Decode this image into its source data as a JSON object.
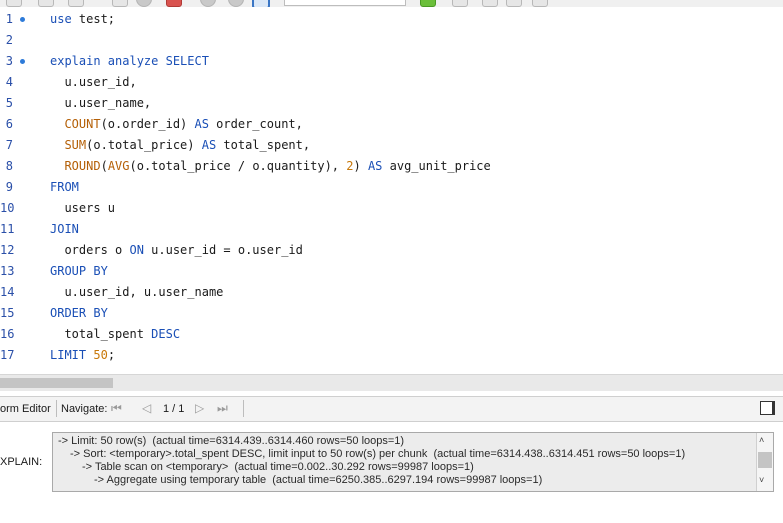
{
  "editor": {
    "lines": [
      {
        "num": "1",
        "marker": true,
        "tokens": [
          {
            "t": "use",
            "c": "kw"
          },
          {
            "t": " test;",
            "c": ""
          }
        ]
      },
      {
        "num": "2",
        "marker": false,
        "tokens": []
      },
      {
        "num": "3",
        "marker": true,
        "tokens": [
          {
            "t": "explain analyze SELECT",
            "c": "kw"
          }
        ]
      },
      {
        "num": "4",
        "marker": false,
        "tokens": [
          {
            "t": "  u.user_id,",
            "c": ""
          }
        ]
      },
      {
        "num": "5",
        "marker": false,
        "tokens": [
          {
            "t": "  u.user_name,",
            "c": ""
          }
        ]
      },
      {
        "num": "6",
        "marker": false,
        "tokens": [
          {
            "t": "  ",
            "c": ""
          },
          {
            "t": "COUNT",
            "c": "fn"
          },
          {
            "t": "(o.order_id) ",
            "c": ""
          },
          {
            "t": "AS",
            "c": "kw"
          },
          {
            "t": " order_count,",
            "c": ""
          }
        ]
      },
      {
        "num": "7",
        "marker": false,
        "tokens": [
          {
            "t": "  ",
            "c": ""
          },
          {
            "t": "SUM",
            "c": "fn"
          },
          {
            "t": "(o.total_price) ",
            "c": ""
          },
          {
            "t": "AS",
            "c": "kw"
          },
          {
            "t": " total_spent,",
            "c": ""
          }
        ]
      },
      {
        "num": "8",
        "marker": false,
        "tokens": [
          {
            "t": "  ",
            "c": ""
          },
          {
            "t": "ROUND",
            "c": "fn"
          },
          {
            "t": "(",
            "c": ""
          },
          {
            "t": "AVG",
            "c": "fn"
          },
          {
            "t": "(o.total_price / o.quantity), ",
            "c": ""
          },
          {
            "t": "2",
            "c": "nm"
          },
          {
            "t": ") ",
            "c": ""
          },
          {
            "t": "AS",
            "c": "kw"
          },
          {
            "t": " avg_unit_price",
            "c": ""
          }
        ]
      },
      {
        "num": "9",
        "marker": false,
        "tokens": [
          {
            "t": "FROM",
            "c": "kw"
          }
        ]
      },
      {
        "num": "10",
        "marker": false,
        "tokens": [
          {
            "t": "  users u",
            "c": ""
          }
        ]
      },
      {
        "num": "11",
        "marker": false,
        "tokens": [
          {
            "t": "JOIN",
            "c": "kw"
          }
        ]
      },
      {
        "num": "12",
        "marker": false,
        "tokens": [
          {
            "t": "  orders o ",
            "c": ""
          },
          {
            "t": "ON",
            "c": "kw"
          },
          {
            "t": " u.user_id = o.user_id",
            "c": ""
          }
        ]
      },
      {
        "num": "13",
        "marker": false,
        "tokens": [
          {
            "t": "GROUP BY",
            "c": "kw"
          }
        ]
      },
      {
        "num": "14",
        "marker": false,
        "tokens": [
          {
            "t": "  u.user_id, u.user_name",
            "c": ""
          }
        ]
      },
      {
        "num": "15",
        "marker": false,
        "tokens": [
          {
            "t": "ORDER BY",
            "c": "kw"
          }
        ]
      },
      {
        "num": "16",
        "marker": false,
        "tokens": [
          {
            "t": "  total_spent ",
            "c": ""
          },
          {
            "t": "DESC",
            "c": "kw"
          }
        ]
      },
      {
        "num": "17",
        "marker": false,
        "tokens": [
          {
            "t": "LIMIT ",
            "c": "kw"
          },
          {
            "t": "50",
            "c": "nm"
          },
          {
            "t": ";",
            "c": ""
          }
        ]
      }
    ]
  },
  "formbar": {
    "title": "orm Editor",
    "navigate_label": "Navigate:",
    "first_icon": "first-page-icon",
    "prev_icon": "previous-page-icon",
    "page_indicator": "1 / 1",
    "next_icon": "next-page-icon",
    "last_icon": "last-page-icon"
  },
  "explain": {
    "label": "XPLAIN:",
    "lines": [
      "-> Limit: 50 row(s)  (actual time=6314.439..6314.460 rows=50 loops=1)",
      "-> Sort: <temporary>.total_spent DESC, limit input to 50 row(s) per chunk  (actual time=6314.438..6314.451 rows=50 loops=1)",
      "-> Table scan on <temporary>  (actual time=0.002..30.292 rows=99987 loops=1)",
      "-> Aggregate using temporary table  (actual time=6250.385..6297.194 rows=99987 loops=1)"
    ]
  }
}
